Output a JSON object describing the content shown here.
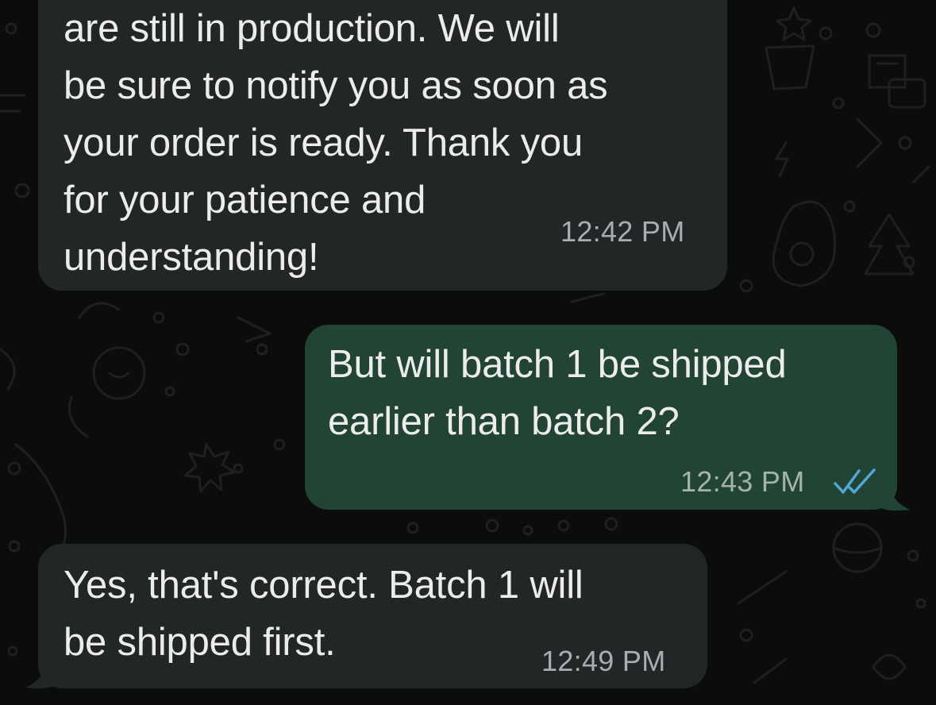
{
  "messages": [
    {
      "direction": "incoming",
      "text": "are still in production. We will\nbe sure to notify you as soon as\nyour order is ready. Thank you\nfor your patience and\nunderstanding!",
      "time": "12:42 PM"
    },
    {
      "direction": "outgoing",
      "text": "But will batch 1 be shipped\nearlier than batch 2?",
      "time": "12:43 PM",
      "status": "read"
    },
    {
      "direction": "incoming",
      "text": "Yes, that's correct. Batch 1 will\nbe shipped first.",
      "time": "12:49 PM"
    }
  ],
  "colors": {
    "background": "#0b0c0c",
    "incoming_bubble": "#232626",
    "outgoing_bubble": "#224434",
    "read_ticks": "#53a6d8"
  },
  "icons": {
    "read_receipt": "double-check-icon",
    "wallpaper": "doodle-pattern"
  }
}
